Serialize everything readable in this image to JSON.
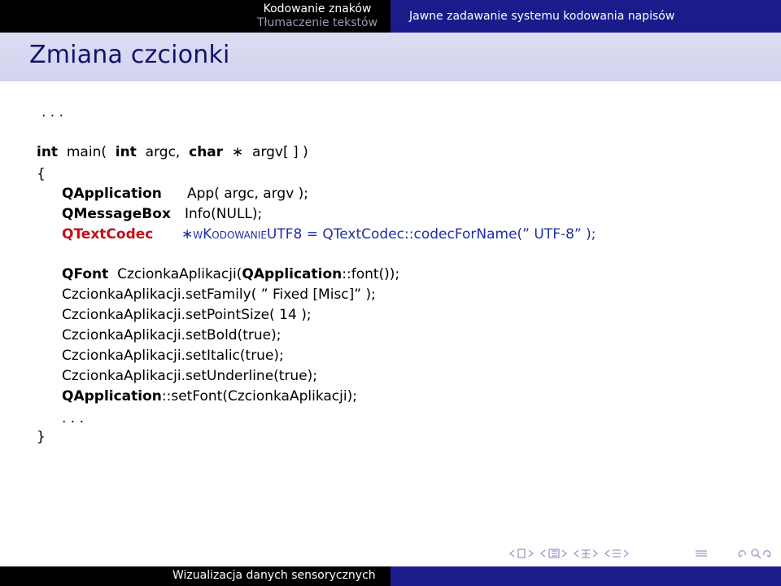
{
  "header": {
    "section_current": "Kodowanie znaków",
    "section_next": "Tłumaczenie tekstów",
    "subsection": "Jawne zadawanie systemu kodowania napisów"
  },
  "slide": {
    "title": "Zmiana czcionki"
  },
  "code": {
    "ellipsis_top": ". . .",
    "l1_int": "int",
    "l1_main": "  main(  ",
    "l1_int2": "int",
    "l1_argc": "  argc,  ",
    "l1_char": "char",
    "l1_rest": "  ∗  argv[ ] )",
    "l2_brace_open": "{",
    "l3_type": "QApplication",
    "l3_rest": "App( argc, argv );",
    "l4_type": "QMessageBox",
    "l4_rest": "Info(NULL);",
    "l5_type": "QTextCodec",
    "l5_star": "∗",
    "l5_var": "wKodowanieUTF8",
    "l5_rest": " = QTextCodec::codecForName(” UTF-8” );",
    "l6_type": "QFont",
    "l6_mid": "  CzcionkaAplikacji(",
    "l6_cls": "QApplication",
    "l6_end": "::font());",
    "l7": "CzcionkaAplikacji.setFamily( ” Fixed [Misc]” );",
    "l8": "CzcionkaAplikacji.setPointSize( 14 );",
    "l9": "CzcionkaAplikacji.setBold(true);",
    "l10": "CzcionkaAplikacji.setItalic(true);",
    "l11": "CzcionkaAplikacji.setUnderline(true);",
    "l12_cls": "QApplication",
    "l12_rest": "::setFont(CzcionkaAplikacji);",
    "ellipsis_inner": ". . .",
    "l14_brace_close": "}"
  },
  "footer": {
    "title": "Wizualizacja danych sensorycznych"
  },
  "colors": {
    "nav_dark": "#000000",
    "nav_blue": "#1b1b8c",
    "title_bg": "#d8d8f0",
    "title_text": "#12126e",
    "keyword_red": "#c1121a",
    "code_blue": "#1d2fa5"
  }
}
